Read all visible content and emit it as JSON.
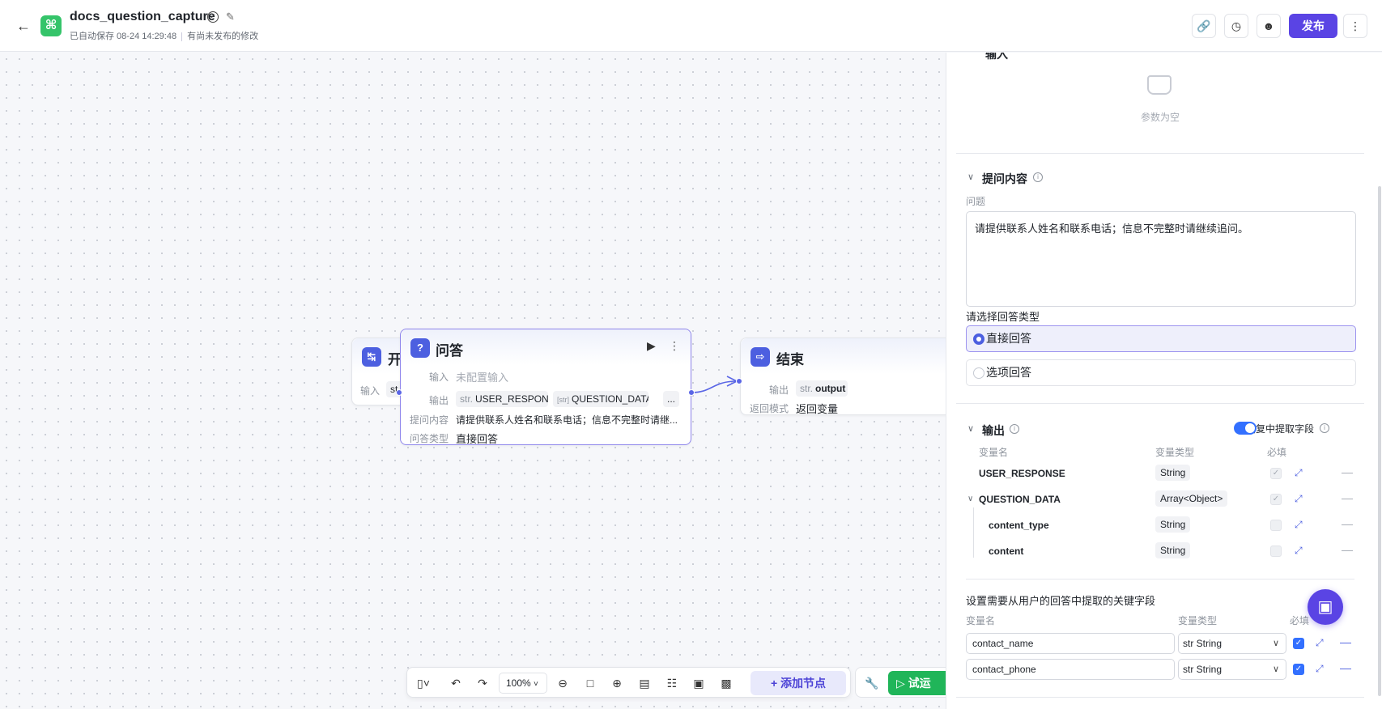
{
  "header": {
    "title": "docs_question_capture",
    "saved_text": "已自动保存 08-24 14:29:48",
    "unpublished_text": "有尚未发布的修改",
    "publish_label": "发布"
  },
  "canvas": {
    "start_node": {
      "title": "开",
      "input_label": "输入",
      "input_tag": "st"
    },
    "qa_node": {
      "title": "问答",
      "input_label": "输入",
      "input_value": "未配置输入",
      "output_label": "输出",
      "output_1_prefix": "str.",
      "output_1": "USER_RESPONSE",
      "output_2_prefix": "[str]",
      "output_2": "QUESTION_DATA",
      "more": "...",
      "prompt_label": "提问内容",
      "prompt_value": "请提供联系人姓名和联系电话；信息不完整时请继...",
      "answer_type_label": "问答类型",
      "answer_type_value": "直接回答"
    },
    "end_node": {
      "title": "结束",
      "output_label": "输出",
      "output_prefix": "str.",
      "output_value": "output",
      "return_label": "返回模式",
      "return_value": "返回变量"
    }
  },
  "toolbar": {
    "zoom": "100%",
    "add_node": "添加节点",
    "trial_run": "试运"
  },
  "panel": {
    "input_section_title": "输入",
    "empty_text": "参数为空",
    "prompt_section": {
      "title": "提问内容",
      "question_label": "问题",
      "question_value": "请提供联系人姓名和联系电话；信息不完整时请继续追问。",
      "answer_type_label": "请选择回答类型",
      "options": [
        "直接回答",
        "选项回答"
      ]
    },
    "output_section": {
      "title": "输出",
      "extract_label": "从回复中提取字段",
      "col_name": "变量名",
      "col_type": "变量类型",
      "col_required": "必填",
      "rows": [
        {
          "name": "USER_RESPONSE",
          "type": "String"
        },
        {
          "name": "QUESTION_DATA",
          "type": "Array<Object>"
        },
        {
          "name": "content_type",
          "type": "String"
        },
        {
          "name": "content",
          "type": "String"
        }
      ]
    },
    "extract_section": {
      "title": "设置需要从用户的回答中提取的关键字段",
      "col_name": "变量名",
      "col_type": "变量类型",
      "col_required": "必填",
      "rows": [
        {
          "name": "contact_name",
          "type": "str String"
        },
        {
          "name": "contact_phone",
          "type": "str String"
        }
      ]
    }
  },
  "icons": {
    "accent": "#5a44e4",
    "node_icon": "#4c5fe0",
    "app_icon": "#35c46a",
    "trial": "#20b559"
  }
}
